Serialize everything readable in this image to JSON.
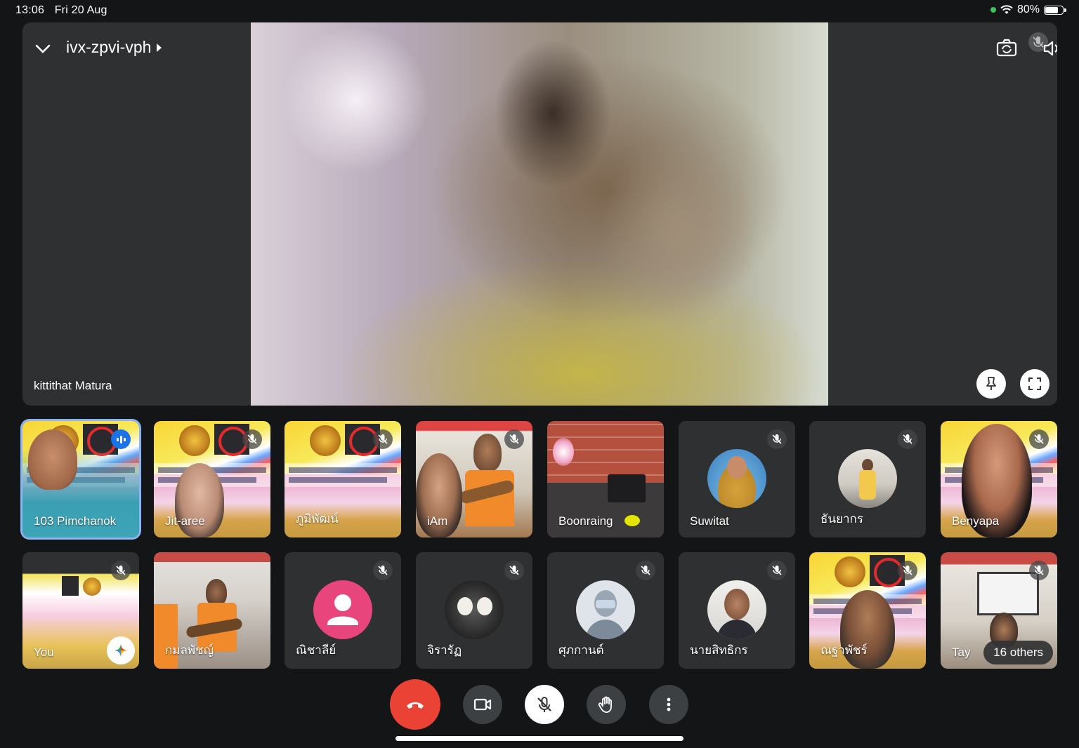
{
  "status_bar": {
    "time": "13:06",
    "date": "Fri 20 Aug",
    "battery": "80%",
    "battery_level": 0.8
  },
  "header": {
    "meeting_code": "ivx-zpvi-vph"
  },
  "stage": {
    "speaker_name": "kittithat Matura"
  },
  "tiles": [
    {
      "name": "103 Pimchanok",
      "state": "speaking"
    },
    {
      "name": "Jit-aree",
      "state": "muted"
    },
    {
      "name": "ภูมิพัฒน์",
      "state": "muted"
    },
    {
      "name": "iAm",
      "state": "muted"
    },
    {
      "name": "Boonraing",
      "state": "unmuted"
    },
    {
      "name": "Suwitat",
      "state": "muted"
    },
    {
      "name": "ธันยากร",
      "state": "muted"
    },
    {
      "name": "Benyapa",
      "state": "muted"
    },
    {
      "name": "You",
      "state": "muted"
    },
    {
      "name": "กมลพัชญ์",
      "state": "unmuted"
    },
    {
      "name": "ณิชาลีย์",
      "state": "muted"
    },
    {
      "name": "จิรารัฏ",
      "state": "muted"
    },
    {
      "name": "ศุภกานต์",
      "state": "muted"
    },
    {
      "name": "นายสิทธิกร",
      "state": "muted"
    },
    {
      "name": "ณฐาพัชร์",
      "state": "muted"
    },
    {
      "name": "Tay",
      "state": "muted"
    }
  ],
  "others": {
    "label": "16 others"
  },
  "colors": {
    "end_call": "#ea4335",
    "speaking": "#1a73e8",
    "active_outline": "#8ab4f8",
    "avatar_pink": "#e8457c"
  },
  "icons": {
    "top": [
      "chevron-down-icon",
      "caret-right-icon",
      "switch-camera-icon",
      "mic-off-icon",
      "speaker-icon"
    ],
    "stage": [
      "pin-icon",
      "fullscreen-icon"
    ],
    "toolbar": [
      "end-call-icon",
      "camera-icon",
      "mic-off-icon",
      "raise-hand-icon",
      "more-vert-icon"
    ]
  }
}
